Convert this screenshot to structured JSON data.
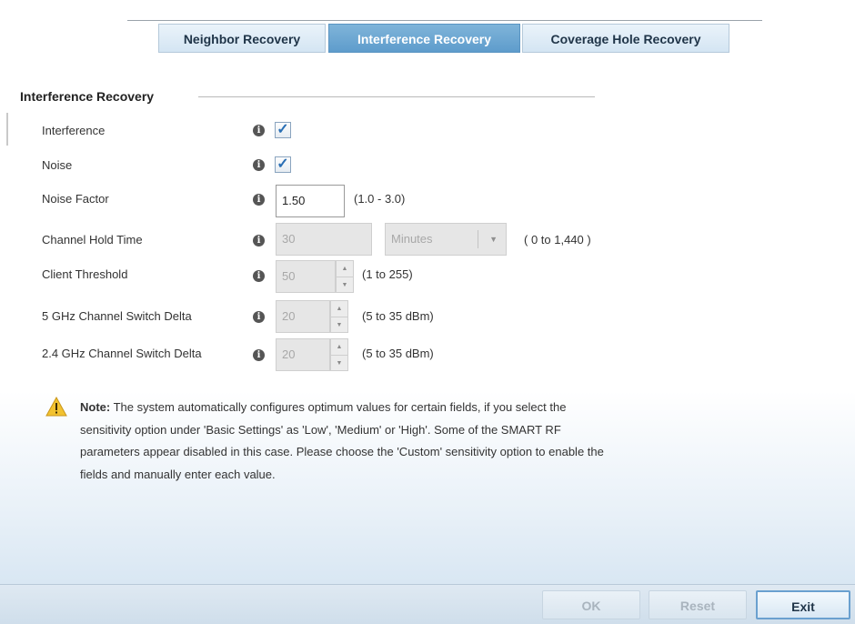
{
  "tabs": [
    {
      "label": "Neighbor Recovery",
      "active": false
    },
    {
      "label": "Interference Recovery",
      "active": true
    },
    {
      "label": "Coverage Hole Recovery",
      "active": false
    }
  ],
  "section": {
    "title": "Interference Recovery"
  },
  "fields": {
    "interference": {
      "label": "Interference",
      "checked": true
    },
    "noise": {
      "label": "Noise",
      "checked": true
    },
    "noise_factor": {
      "label": "Noise Factor",
      "value": "1.50",
      "range": "(1.0 - 3.0)"
    },
    "channel_hold_time": {
      "label": "Channel Hold Time",
      "value": "30",
      "unit": "Minutes",
      "range": "( 0 to 1,440 )"
    },
    "client_threshold": {
      "label": "Client Threshold",
      "value": "50",
      "range": "(1 to 255)"
    },
    "ghz5_delta": {
      "label": "5 GHz Channel Switch Delta",
      "value": "20",
      "range": "(5 to 35 dBm)"
    },
    "ghz24_delta": {
      "label": "2.4 GHz Channel Switch Delta",
      "value": "20",
      "range": "(5 to 35 dBm)"
    }
  },
  "note": {
    "prefix": "Note:",
    "text": " The system automatically configures optimum values for certain fields, if you select the sensitivity option under 'Basic Settings' as 'Low', 'Medium' or 'High'. Some of the SMART RF parameters appear disabled in this case. Please choose the 'Custom' sensitivity option to enable the fields and manually enter each value."
  },
  "footer": {
    "ok_label": "OK",
    "reset_label": "Reset",
    "exit_label": "Exit"
  },
  "icons": {
    "info": "info-icon",
    "warning": "warning-icon",
    "check": "checkmark-icon"
  },
  "colors": {
    "active_tab": "#6fa8d4",
    "tab_text": "#1f3448",
    "check": "#2a6fb5"
  }
}
